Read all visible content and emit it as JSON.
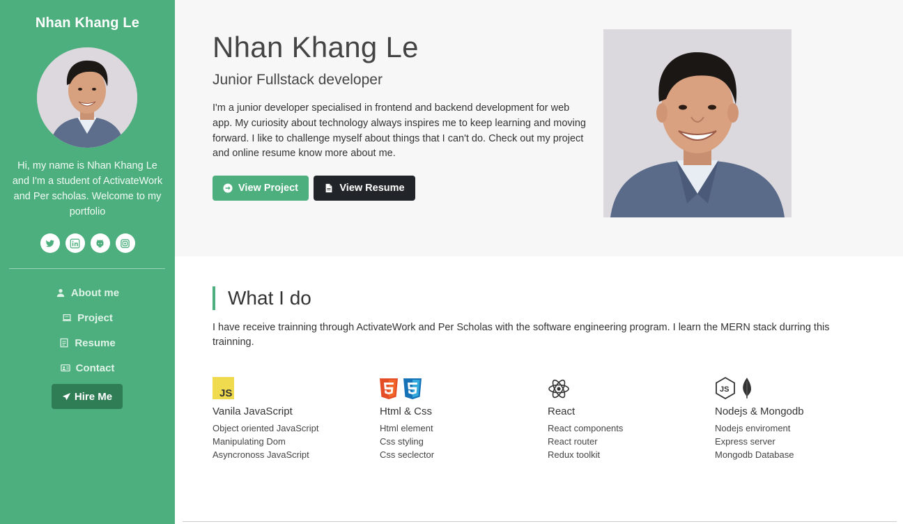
{
  "sidebar": {
    "name": "Nhan Khang Le",
    "intro": "Hi, my name is Nhan Khang Le and I'm a student of ActivateWork and Per scholas. Welcome to my portfolio",
    "socials": [
      "twitter-icon",
      "linkedin-icon",
      "github-icon",
      "instagram-icon"
    ],
    "nav": [
      {
        "label": "About me",
        "icon": "user-icon"
      },
      {
        "label": "Project",
        "icon": "laptop-icon"
      },
      {
        "label": "Resume",
        "icon": "document-icon"
      },
      {
        "label": "Contact",
        "icon": "contact-card-icon"
      }
    ],
    "hire_label": "Hire Me"
  },
  "hero": {
    "name": "Nhan Khang Le",
    "role": "Junior Fullstack developer",
    "description": "I'm a junior developer specialised in frontend and backend development for web app. My curiosity about technology always inspires me to keep learning and moving forward. I like to challenge myself about things that I can't do. Check out my project and online resume know more about me.",
    "view_project_label": "View Project",
    "view_resume_label": "View Resume"
  },
  "what_i_do": {
    "title": "What I do",
    "description": "I have receive trainning through ActivateWork and Per Scholas with the software engineering program. I learn the MERN stack durring this trainning.",
    "skills": [
      {
        "title": "Vanila JavaScript",
        "icons": [
          "javascript-icon"
        ],
        "items": [
          "Object oriented JavaScript",
          "Manipulating Dom",
          "Asyncronoss JavaScript"
        ]
      },
      {
        "title": "Html & Css",
        "icons": [
          "html5-icon",
          "css3-icon"
        ],
        "items": [
          "Html element",
          "Css styling",
          "Css seclector"
        ]
      },
      {
        "title": "React",
        "icons": [
          "react-icon"
        ],
        "items": [
          "React components",
          "React router",
          "Redux toolkit"
        ]
      },
      {
        "title": "Nodejs & Mongodb",
        "icons": [
          "nodejs-icon",
          "mongodb-leaf-icon"
        ],
        "items": [
          "Nodejs enviroment",
          "Express server",
          "Mongodb Database"
        ]
      }
    ]
  },
  "colors": {
    "accent": "#4caf7d",
    "accent_dark": "#2e7d55",
    "dark_button": "#212529",
    "hero_bg": "#f7f7f7"
  }
}
